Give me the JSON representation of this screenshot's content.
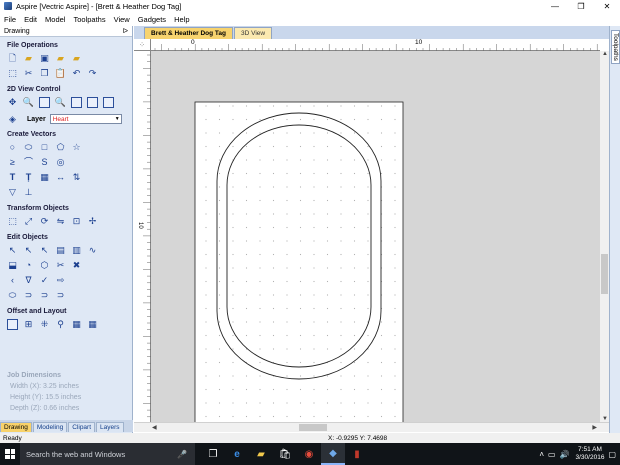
{
  "window": {
    "title": "Aspire [Vectric Aspire] - [Brett & Heather Dog Tag]",
    "minimize": "—",
    "maximize": "❐",
    "close": "✕"
  },
  "menu": [
    "File",
    "Edit",
    "Model",
    "Toolpaths",
    "View",
    "Gadgets",
    "Help"
  ],
  "left_panel": {
    "header": "Drawing",
    "pin": "ᐅ",
    "sections": {
      "file_operations": "File Operations",
      "view_control": "2D View Control",
      "create_vectors": "Create Vectors",
      "transform_objects": "Transform Objects",
      "edit_objects": "Edit Objects",
      "offset_layout": "Offset and Layout"
    },
    "layer": {
      "label": "Layer",
      "value": "Heart"
    },
    "job_dimensions": {
      "title": "Job Dimensions",
      "width": "Width  (X): 3.25 inches",
      "height": "Height (Y): 15.5 inches",
      "depth": "Depth  (Z): 0.66 inches"
    },
    "tabs": [
      "Drawing",
      "Modeling",
      "Clipart",
      "Layers"
    ]
  },
  "doc_tabs": [
    "Brett & Heather Dog Tag",
    "3D View"
  ],
  "right_tab": "Toolpaths",
  "ruler": {
    "top_labels": [
      "0",
      "10"
    ],
    "left_label": "10"
  },
  "status": {
    "ready": "Ready",
    "coords": "X: -0.9295 Y:  7.4698"
  },
  "taskbar": {
    "search": "Search the web and Windows",
    "time": "7:51 AM",
    "date": "3/30/2016"
  },
  "icons": {
    "file_ops": [
      "new-file-icon",
      "open-folder-icon",
      "save-icon",
      "save-as-icon",
      "folder-star-icon",
      "fit-view-icon",
      "cut-icon",
      "copy-icon",
      "paste-icon",
      "undo-icon",
      "redo-icon"
    ]
  }
}
